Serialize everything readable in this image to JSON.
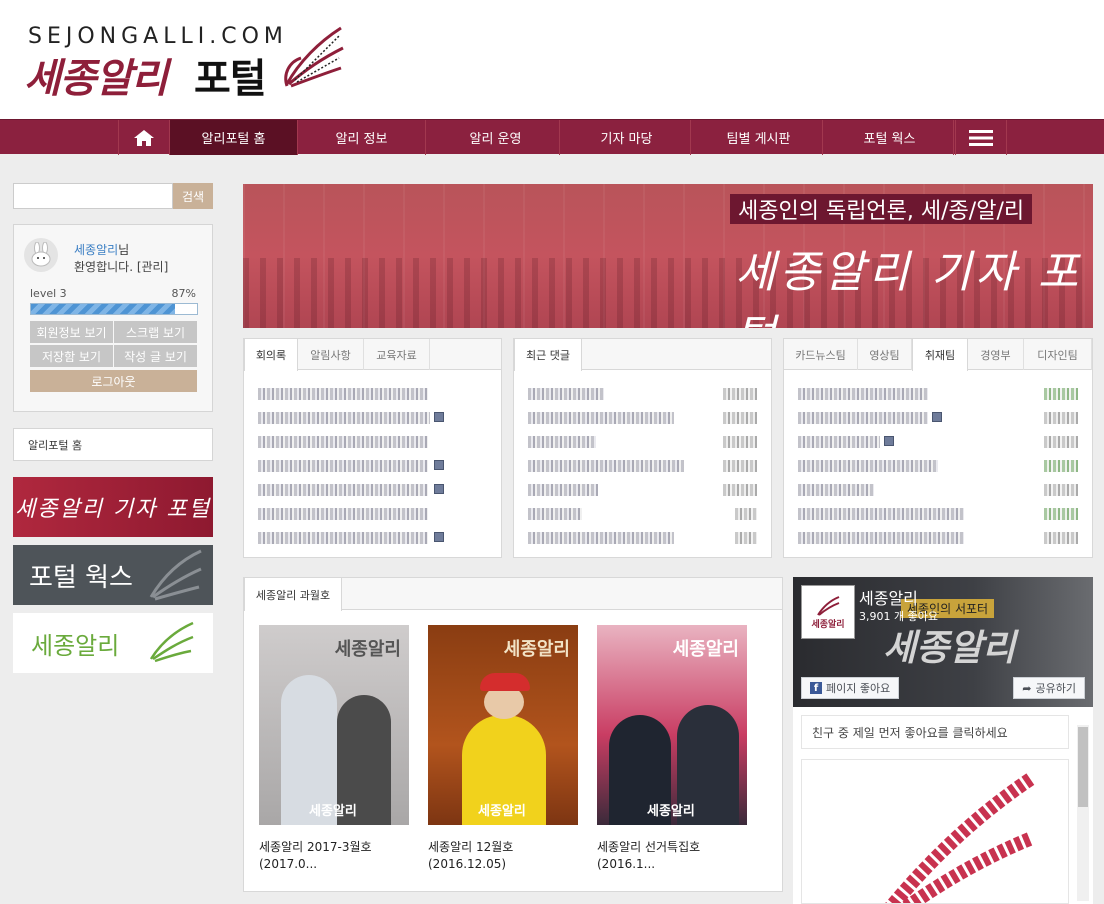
{
  "header": {
    "domain": "SEJONGALLI.COM",
    "brand_red": "세종알리",
    "brand_black": "포털"
  },
  "nav": {
    "items": [
      "알리포털 홈",
      "알리 정보",
      "알리 운영",
      "기자 마당",
      "팀별 게시판",
      "포털 웍스"
    ],
    "active_index": 0,
    "home_icon": "home-icon",
    "menu_icon": "hamburger-icon"
  },
  "search": {
    "placeholder": "",
    "button": "검색"
  },
  "user": {
    "name": "세종알리",
    "name_suffix": "님",
    "welcome": "환영합니다. [관리]",
    "level": "level 3",
    "progress_pct": "87%",
    "progress": 0.87,
    "buttons": [
      "회원정보 보기",
      "스크랩 보기",
      "저장함 보기",
      "작성 글 보기"
    ],
    "logout": "로그아웃"
  },
  "sidenav": {
    "label": "알리포털 홈"
  },
  "banners": {
    "reporter_portal": "세종알리 기자 포털",
    "portal_works": "포털 웍스",
    "sejongalli": "세종알리"
  },
  "hero": {
    "tag": "세종인의 독립언론, 세/종/알/리",
    "title": "세종알리 기자 포털"
  },
  "boxes": {
    "box1_tabs": [
      "회의록",
      "알림사항",
      "교육자료"
    ],
    "box2_tabs": [
      "최근 댓글"
    ],
    "box3_tabs": [
      "카드뉴스팀",
      "영상팀",
      "취재팀",
      "경영부",
      "디자인팀"
    ]
  },
  "magazine": {
    "tab": "세종알리 과월호",
    "items": [
      {
        "title": "세종알리 2017-3월호",
        "date": "(2017.0..."
      },
      {
        "title": "세종알리 12월호",
        "date": "(2016.12.05)"
      },
      {
        "title": "세종알리 선거특집호",
        "date": "(2016.1..."
      }
    ],
    "cover_brand": "세종알리"
  },
  "facebook": {
    "page_name": "세종알리",
    "likes": "3,901 개 좋아요",
    "supporter": "세종인의 서포터",
    "cover_text": "세종알리",
    "like_button": "페이지 좋아요",
    "share_button": "공유하기",
    "hint": "친구 중 제일 먼저 좋아요를 클릭하세요"
  },
  "colors": {
    "brand": "#8b213f",
    "nav_active": "#5b1024",
    "beige": "#c9b198"
  }
}
